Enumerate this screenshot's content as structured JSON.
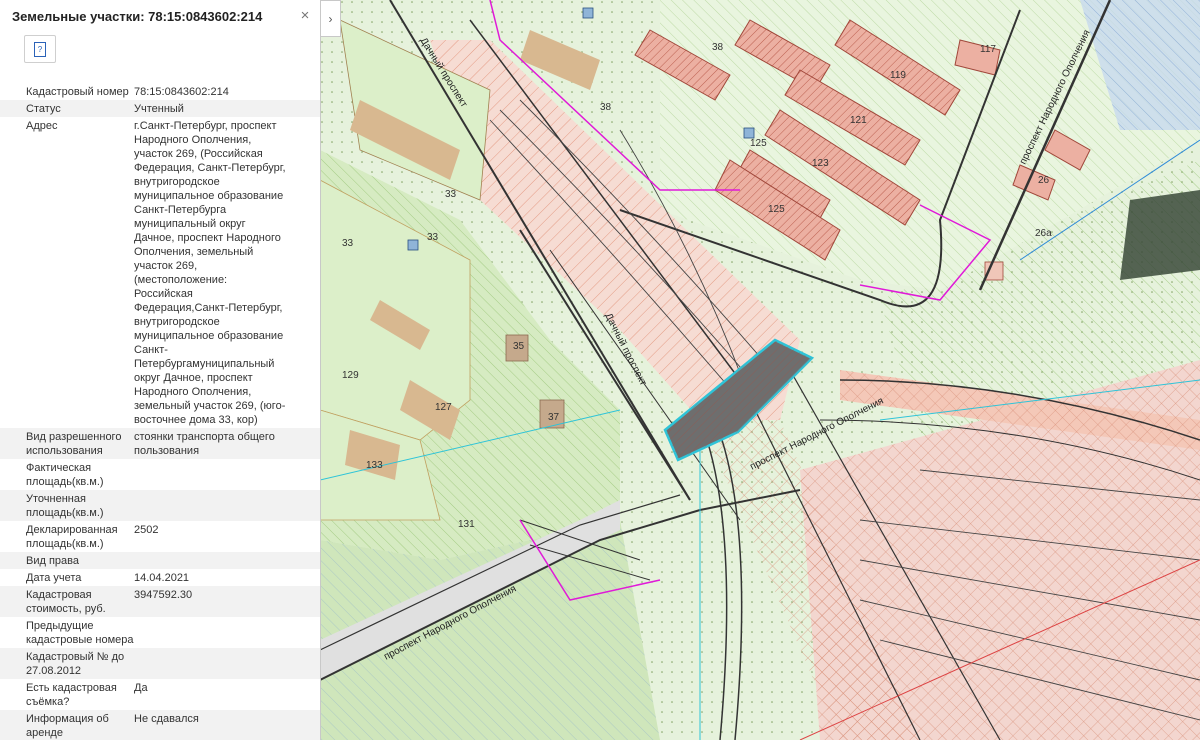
{
  "panel": {
    "title": "Земельные участки: 78:15:0843602:214",
    "close_icon": "×",
    "doc_icon": "?",
    "toggle_icon": "›"
  },
  "attributes": [
    {
      "label": "Кадастровый номер",
      "value": "78:15:0843602:214"
    },
    {
      "label": "Статус",
      "value": "Учтенный"
    },
    {
      "label": "Адрес",
      "value": "г.Санкт-Петербург, проспект Народного Ополчения, участок 269, (Российская Федерация, Санкт-Петербург, внутригородское муниципальное образование Санкт-Петербурга муниципальный округ Дачное, проспект Народного Ополчения, земельный участок 269, (местоположение: Российская Федерация,Санкт-Петербург, внутригородское муниципальное образование Санкт-Петербургамуниципальный округ Дачное, проспект Народного Ополчения, земельный участок 269, (юго-восточнее дома 33, кор)"
    },
    {
      "label": "Вид разрешенного использования",
      "value": "стоянки транспорта общего пользования"
    },
    {
      "label": "Фактическая площадь(кв.м.)",
      "value": ""
    },
    {
      "label": "Уточненная площадь(кв.м.)",
      "value": ""
    },
    {
      "label": "Декларированная площадь(кв.м.)",
      "value": "2502"
    },
    {
      "label": "Вид права",
      "value": ""
    },
    {
      "label": "Дата учета",
      "value": "14.04.2021"
    },
    {
      "label": "Кадастровая стоимость, руб.",
      "value": "3947592.30"
    },
    {
      "label": "Предыдущие кадастровые номера",
      "value": ""
    },
    {
      "label": "Кадастровый № до 27.08.2012",
      "value": ""
    },
    {
      "label": "Есть кадастровая съёмка?",
      "value": "Да"
    },
    {
      "label": "Информация об аренде",
      "value": "Не сдавался"
    }
  ],
  "map": {
    "street_labels": [
      "Дачный проспект",
      "Дачный проспект",
      "проспект Народного Ополчения",
      "проспект Народного Ополчения",
      "проспект Народного Ополчения"
    ],
    "building_numbers": [
      "38",
      "117",
      "119",
      "121",
      "123",
      "125",
      "125",
      "26",
      "26а",
      "33",
      "33",
      "33",
      "35",
      "127",
      "129",
      "37",
      "133",
      "131"
    ],
    "colors": {
      "base": "#e6f2dc",
      "green": "#cfeab9",
      "building": "#ecb0a2",
      "road": "#ececec",
      "road_line": "#333333",
      "selected": "#6e6e6e",
      "selected_outline": "#2ec4d8",
      "magenta": "#e01ad8"
    }
  }
}
